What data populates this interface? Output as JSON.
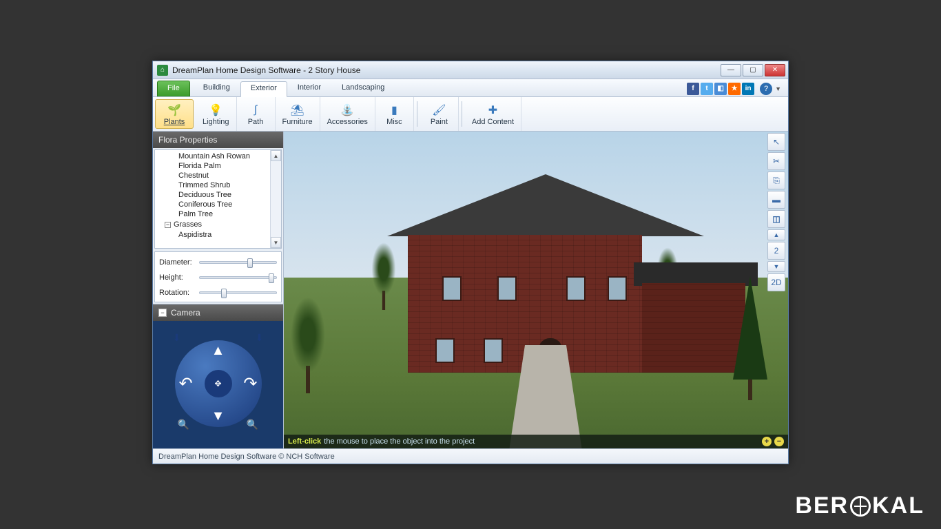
{
  "window": {
    "title": "DreamPlan Home Design Software - 2 Story House"
  },
  "tabs": {
    "file": "File",
    "items": [
      "Building",
      "Exterior",
      "Interior",
      "Landscaping"
    ],
    "active_index": 1
  },
  "toolbar": [
    {
      "label": "Plants",
      "icon": "🌱",
      "selected": true
    },
    {
      "label": "Lighting",
      "icon": "💡"
    },
    {
      "label": "Path",
      "icon": "〰"
    },
    {
      "label": "Furniture",
      "icon": "🪑"
    },
    {
      "label": "Accessories",
      "icon": "⛲"
    },
    {
      "label": "Misc",
      "icon": "▮"
    },
    {
      "sep": true
    },
    {
      "label": "Paint",
      "icon": "🖌"
    },
    {
      "sep": true
    },
    {
      "label": "Add Content",
      "icon": "➕"
    }
  ],
  "flora_panel": {
    "title": "Flora Properties",
    "items": [
      "Mountain Ash Rowan",
      "Florida Palm",
      "Chestnut",
      "Trimmed Shrub",
      "Deciduous Tree",
      "Coniferous Tree",
      "Palm Tree"
    ],
    "group": "Grasses",
    "group_child": "Aspidistra"
  },
  "sliders": [
    {
      "label": "Diameter:",
      "pos": 62
    },
    {
      "label": "Height:",
      "pos": 90
    },
    {
      "label": "Rotation:",
      "pos": 28
    }
  ],
  "camera_panel": {
    "title": "Camera"
  },
  "view_tools": {
    "floor_num": "2",
    "mode_2d": "2D"
  },
  "hint": {
    "key": "Left-click",
    "text": "the mouse to place the object into the project"
  },
  "statusbar": "DreamPlan Home Design Software © NCH Software",
  "watermark": {
    "pre": "BER",
    "post": "KAL"
  }
}
